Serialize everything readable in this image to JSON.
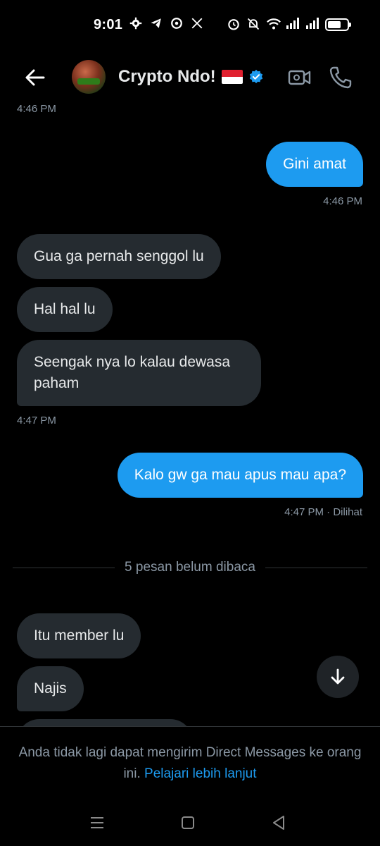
{
  "status_bar": {
    "time": "9:01",
    "left_icons": [
      "gear-icon",
      "telegram-icon",
      "vpn-icon",
      "x-logo-icon"
    ],
    "right_icons": [
      "alarm-icon",
      "mute-icon",
      "wifi-icon",
      "signal-icon",
      "signal-icon",
      "battery-icon"
    ]
  },
  "header": {
    "contact_name": "Crypto Ndo!",
    "verified": true,
    "flag": "indonesia-flag",
    "accent_color": "#1d9bf0"
  },
  "messages": [
    {
      "type": "timestamp",
      "side": "left",
      "text": "4:46 PM"
    },
    {
      "type": "bubble",
      "side": "out",
      "text": "Gini amat"
    },
    {
      "type": "timestamp",
      "side": "right",
      "text": "4:46 PM"
    },
    {
      "type": "bubble",
      "side": "in",
      "text": "Gua ga pernah senggol lu"
    },
    {
      "type": "bubble",
      "side": "in",
      "text": "Hal hal lu"
    },
    {
      "type": "bubble",
      "side": "in",
      "text": "Seengak nya lo kalau dewasa paham"
    },
    {
      "type": "timestamp",
      "side": "left",
      "text": "4:47 PM"
    },
    {
      "type": "bubble",
      "side": "out",
      "text": "Kalo gw ga mau apus mau apa?"
    },
    {
      "type": "timestamp",
      "side": "right",
      "text": "4:47 PM · Dilihat"
    },
    {
      "type": "divider",
      "text": "5 pesan belum dibaca"
    },
    {
      "type": "bubble",
      "side": "in",
      "text": "Itu member lu"
    },
    {
      "type": "bubble",
      "side": "in",
      "text": "Najis"
    }
  ],
  "footer": {
    "notice": "Anda tidak lagi dapat mengirim Direct Messages ke orang ini.",
    "link": "Pelajari lebih lanjut"
  },
  "colors": {
    "background": "#000000",
    "incoming_bubble": "#252b30",
    "outgoing_bubble": "#1d9bf0",
    "muted_text": "#8b98a5"
  }
}
